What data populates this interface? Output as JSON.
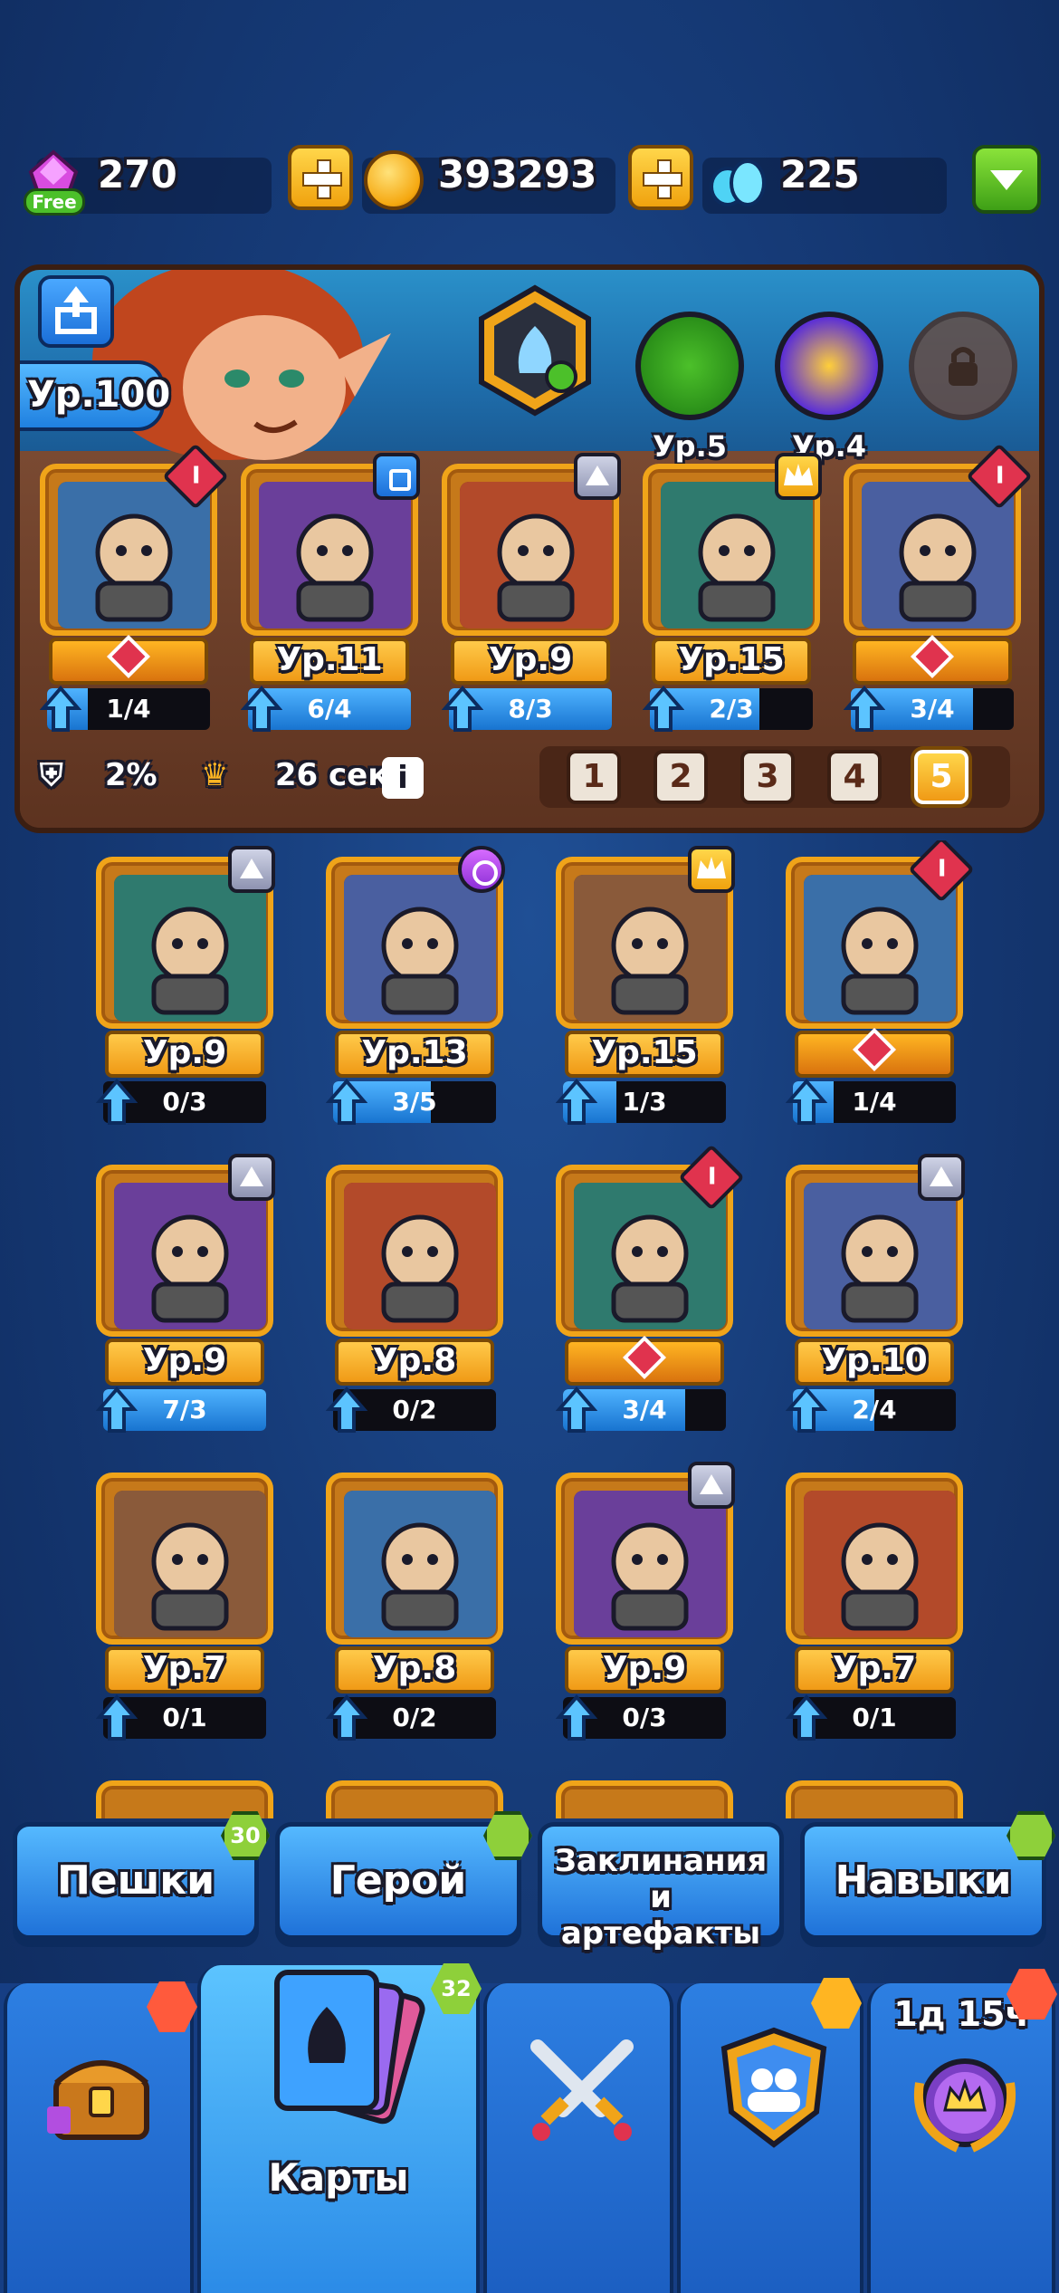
{
  "currencies": {
    "gems": "270",
    "gems_badge": "Free",
    "coins": "393293",
    "crystals": "225"
  },
  "deck": {
    "level_label": "Ур.100",
    "slots": [
      {
        "label": "Ур.5"
      },
      {
        "label": "Ур.4"
      }
    ],
    "cards": [
      {
        "level": "",
        "progress": "1/4",
        "fill": 0.25,
        "badge": "i"
      },
      {
        "level": "Ур.11",
        "progress": "6/4",
        "fill": 1.0,
        "badge": "sq"
      },
      {
        "level": "Ур.9",
        "progress": "8/3",
        "fill": 1.0,
        "badge": "tri"
      },
      {
        "level": "Ур.15",
        "progress": "2/3",
        "fill": 0.67,
        "badge": "crown"
      },
      {
        "level": "",
        "progress": "3/4",
        "fill": 0.75,
        "badge": "i"
      }
    ],
    "percent": "2%",
    "timer": "26 сек.",
    "info": "i",
    "pages": [
      "1",
      "2",
      "3",
      "4",
      "5"
    ],
    "active_page": 4
  },
  "collection": [
    {
      "level": "Ур.9",
      "progress": "0/3",
      "fill": 0.0,
      "badge": "tri"
    },
    {
      "level": "Ур.13",
      "progress": "3/5",
      "fill": 0.6,
      "badge": "circ"
    },
    {
      "level": "Ур.15",
      "progress": "1/3",
      "fill": 0.33,
      "badge": "crown"
    },
    {
      "level": "",
      "progress": "1/4",
      "fill": 0.25,
      "badge": "i"
    },
    {
      "level": "Ур.9",
      "progress": "7/3",
      "fill": 1.0,
      "badge": "tri"
    },
    {
      "level": "Ур.8",
      "progress": "0/2",
      "fill": 0.0,
      "badge": ""
    },
    {
      "level": "",
      "progress": "3/4",
      "fill": 0.75,
      "badge": "i"
    },
    {
      "level": "Ур.10",
      "progress": "2/4",
      "fill": 0.5,
      "badge": "tri"
    },
    {
      "level": "Ур.7",
      "progress": "0/1",
      "fill": 0.0,
      "badge": ""
    },
    {
      "level": "Ур.8",
      "progress": "0/2",
      "fill": 0.0,
      "badge": ""
    },
    {
      "level": "Ур.9",
      "progress": "0/3",
      "fill": 0.0,
      "badge": "tri"
    },
    {
      "level": "Ур.7",
      "progress": "0/1",
      "fill": 0.0,
      "badge": ""
    }
  ],
  "categories": [
    {
      "label": "Пешки",
      "badge": "30"
    },
    {
      "label": "Герой",
      "badge": ""
    },
    {
      "label": "Заклинания и артефакты",
      "badge": ""
    },
    {
      "label": "Навыки",
      "badge": ""
    }
  ],
  "nav": {
    "chest": "",
    "cards_label": "Карты",
    "cards_badge": "32",
    "battle": "",
    "clan": "",
    "events_timer": "1д 15ч"
  },
  "colors": {
    "background": "#163b78",
    "gold": "#f0a419",
    "blue": "#1f80e0",
    "green": "#8ed03a"
  }
}
